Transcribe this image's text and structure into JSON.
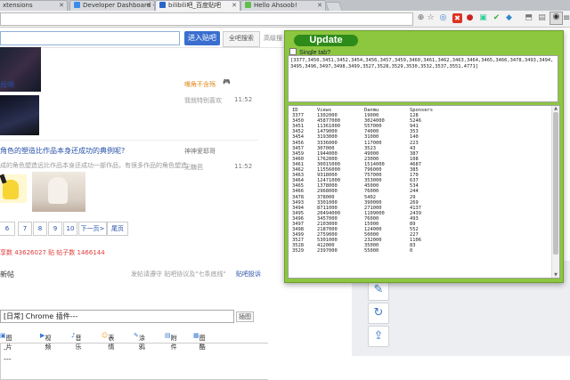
{
  "tabs": [
    {
      "label": "xtensions"
    },
    {
      "label": "Developer Dashboard - C"
    },
    {
      "label": "bilibili吧_百度贴吧"
    },
    {
      "label": "Hello Ahsoob!"
    }
  ],
  "toolbar": {
    "ext_badge": "1"
  },
  "page": {
    "enter_bar_label": "进入贴吧",
    "web_search_label": "全吧搜索",
    "advanced_label": "高级搜",
    "thread1_title": "局啊",
    "thread1_user": "嘴角不含殇",
    "thread1_reply": "我就特别喜欢",
    "thread1_time": "11:52",
    "thread2_title": "角色的塑造比作品本身还成功的典例呢?",
    "thread2_snippet": "成的角色塑造远比作品本身还成功一部作品，有很多作品的角色塑造",
    "thread2_user": "神神爱耶哥",
    "thread2_reply": "无糖芭",
    "thread2_time": "11:52",
    "pager": [
      "6",
      "7",
      "8",
      "9",
      "10",
      "下一页>",
      "尾页"
    ],
    "stats": "享数 43626027 贴 帖子数 1466144",
    "post_title_label": "新帖",
    "post_rules_link": "发帖请遵守 贴吧协议及\"七条底线\"",
    "post_report_link": "贴吧投诉",
    "post_input_value": "[日常] Chrome 插件---",
    "post_input_btn": "插图",
    "tools": [
      "图片",
      "视频",
      "音乐",
      "表情",
      "涂鸦",
      "附件",
      "图酷"
    ],
    "editor_lines": [
      "-",
      "---"
    ]
  },
  "popup": {
    "update_label": "Update",
    "single_tab_label": "Single tab?",
    "ids_text": "[3377,3450,3451,3452,3454,3456,3457,3459,3460,3461,3462,3463,3464,3465,3466,3478,3493,3494,3495,3496,3497,3498,3499,3527,3528,3529,3530,3532,3537,3551,4771]",
    "headers": [
      "ID",
      "Views",
      "Danmu",
      "Sponsers"
    ],
    "rows": [
      [
        "3377",
        "1302000",
        "19000",
        "128"
      ],
      [
        "3450",
        "45877000",
        "3024000",
        "5246"
      ],
      [
        "3451",
        "11361000",
        "557000",
        "941"
      ],
      [
        "3452",
        "1479000",
        "74000",
        "353"
      ],
      [
        "3454",
        "3193000",
        "31000",
        "140"
      ],
      [
        "3456",
        "3336000",
        "117000",
        "223"
      ],
      [
        "3457",
        "307000",
        "3523",
        "43"
      ],
      [
        "3459",
        "1944000",
        "49000",
        "387"
      ],
      [
        "3460",
        "1762000",
        "23000",
        "108"
      ],
      [
        "3461",
        "30015000",
        "1514000",
        "4687"
      ],
      [
        "3462",
        "11556000",
        "796000",
        "385"
      ],
      [
        "3463",
        "9318000",
        "757000",
        "170"
      ],
      [
        "3464",
        "12471000",
        "353000",
        "637"
      ],
      [
        "3465",
        "1378000",
        "45000",
        "534"
      ],
      [
        "3466",
        "2968000",
        "76000",
        "244"
      ],
      [
        "3478",
        "378000",
        "5402",
        "29"
      ],
      [
        "3493",
        "3301000",
        "390000",
        "269"
      ],
      [
        "3494",
        "8711000",
        "271000",
        "4137"
      ],
      [
        "3495",
        "20494000",
        "1109000",
        "2439"
      ],
      [
        "3496",
        "3457000",
        "76000",
        "493"
      ],
      [
        "3497",
        "2103000",
        "15000",
        "89"
      ],
      [
        "3498",
        "2187000",
        "124000",
        "552"
      ],
      [
        "3499",
        "2759000",
        "50000",
        "227"
      ],
      [
        "3527",
        "5301000",
        "232000",
        "1106"
      ],
      [
        "3528",
        "412000",
        "35000",
        "83"
      ],
      [
        "3529",
        "2397000",
        "55000",
        "0"
      ]
    ]
  }
}
